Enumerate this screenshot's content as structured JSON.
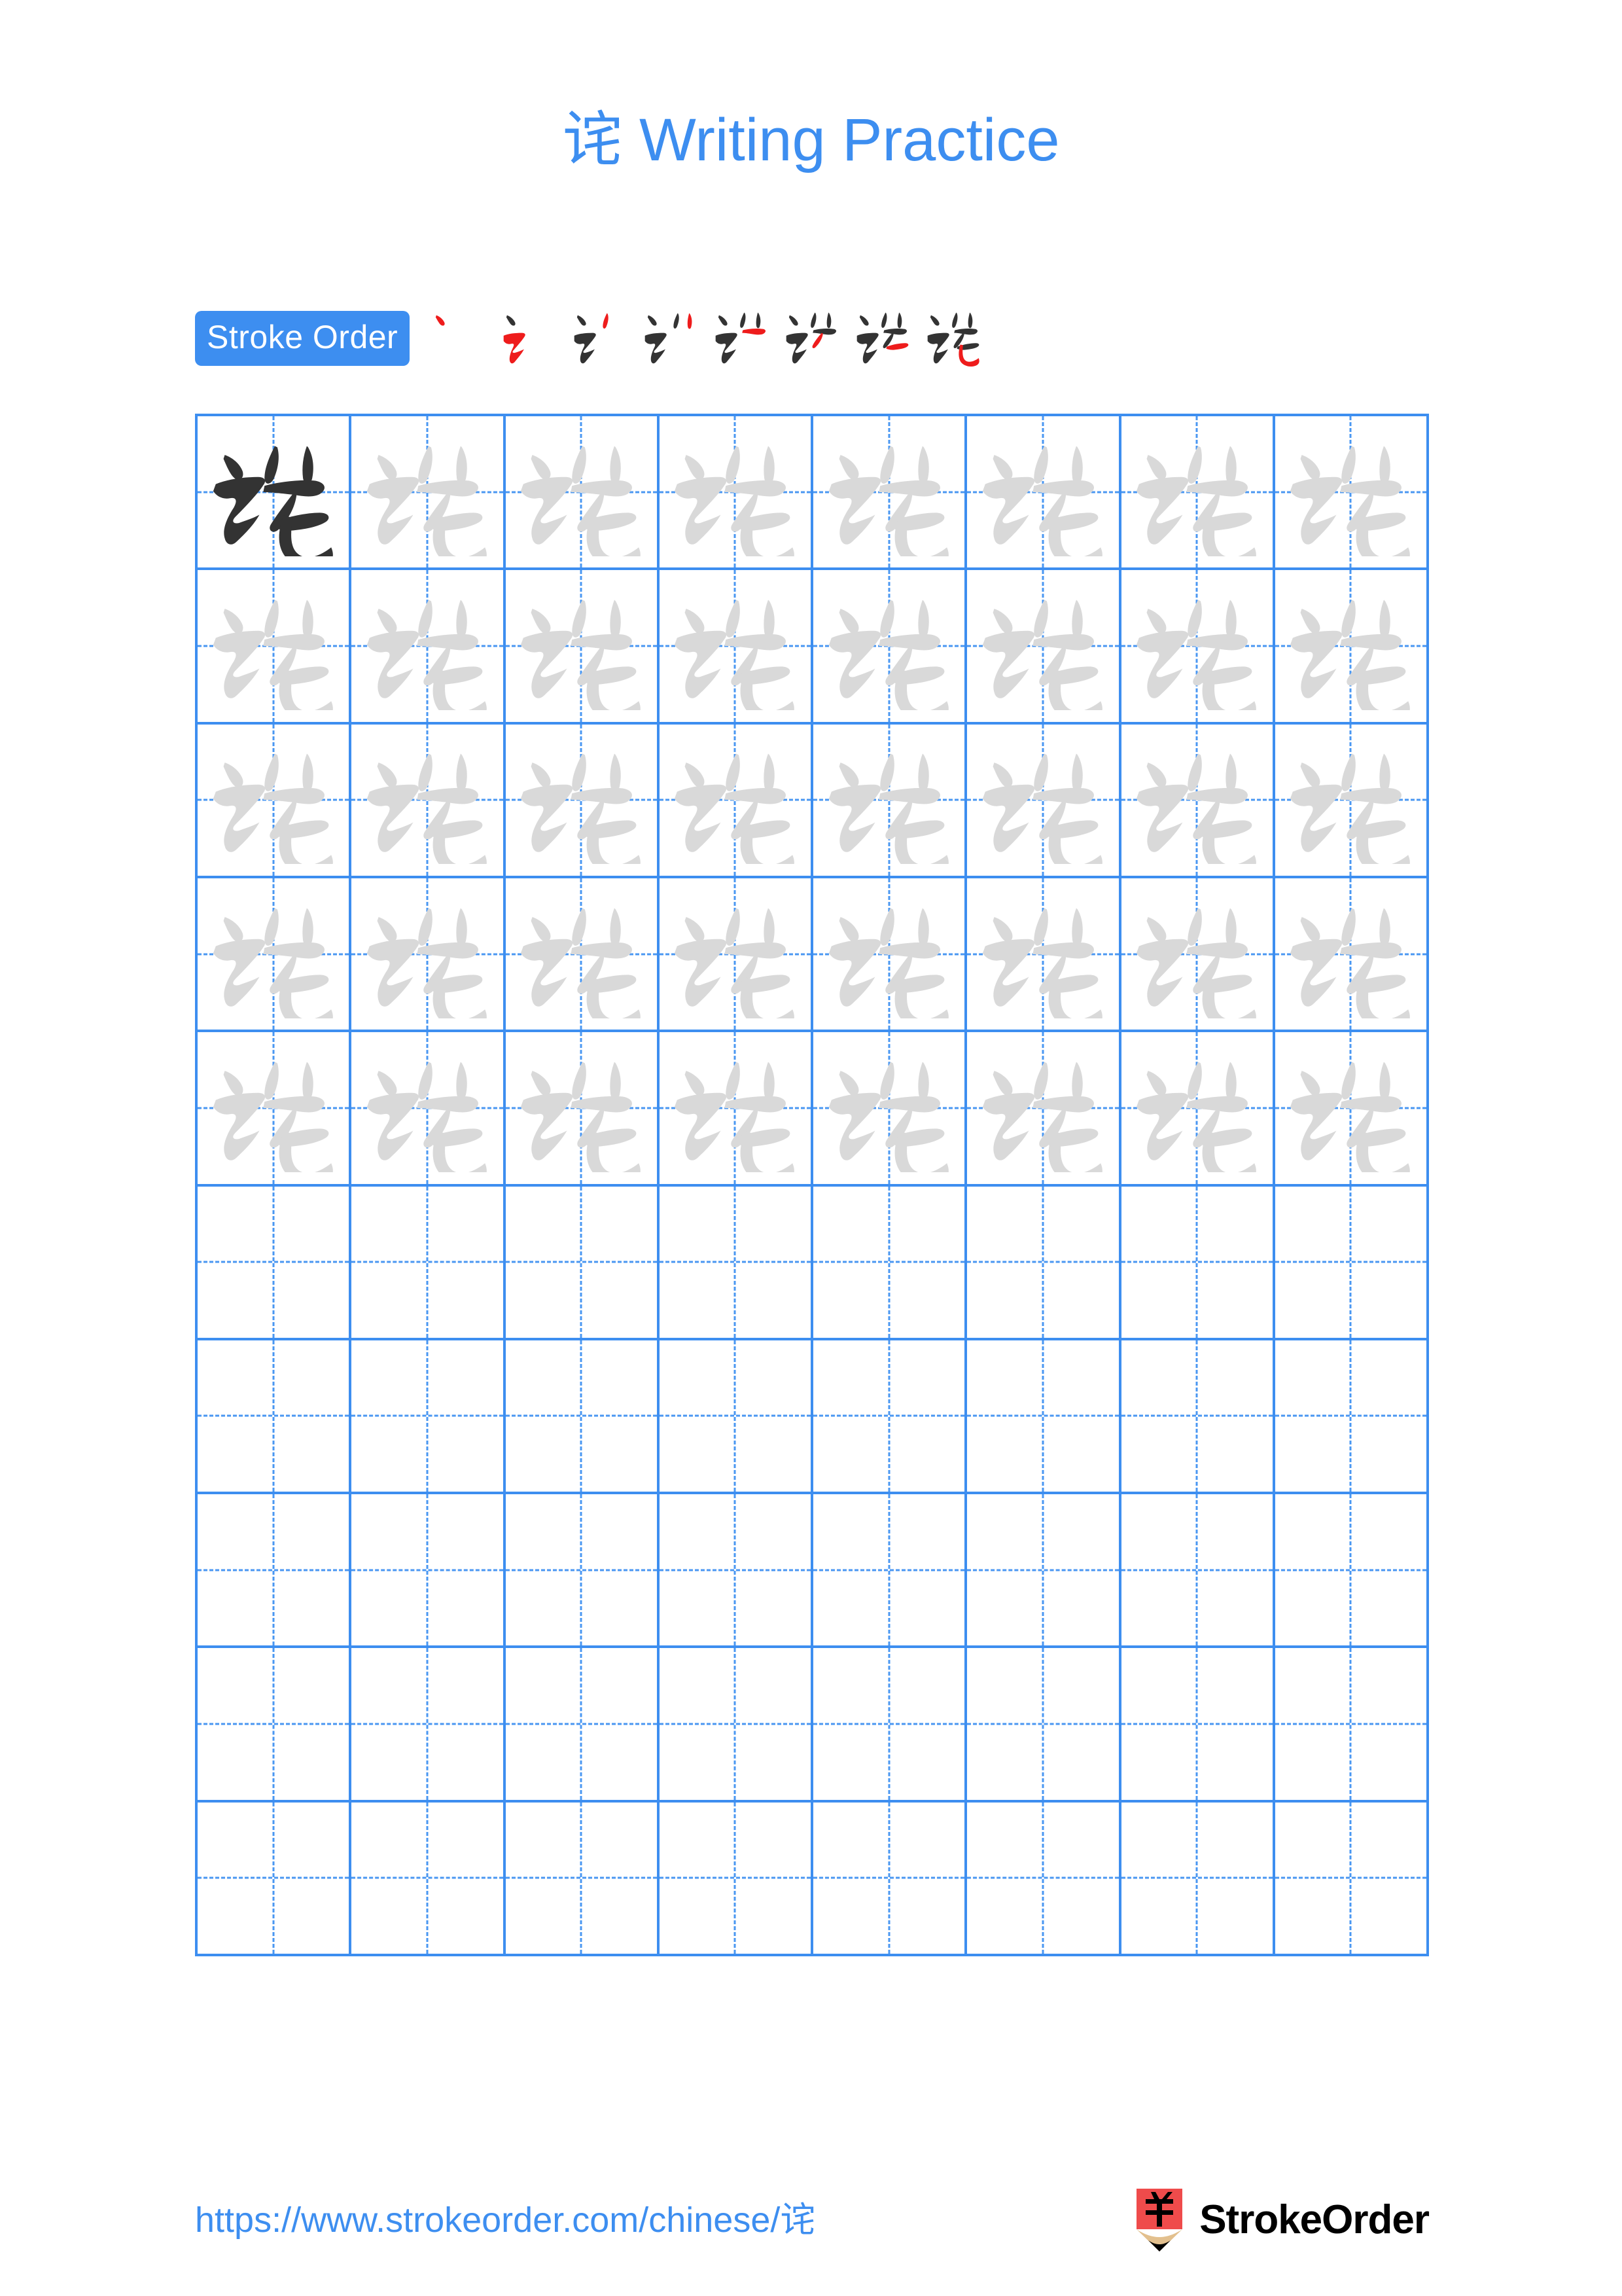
{
  "character": "诧",
  "header": {
    "title": "诧 Writing Practice"
  },
  "stroke_order": {
    "badge_label": "Stroke Order",
    "step_count": 8,
    "new_stroke_color": "#ee1c1c",
    "done_stroke_color": "#333333",
    "steps": [
      {
        "index": 1,
        "strokes_shown": 1,
        "new_stroke": "点 (dot)"
      },
      {
        "index": 2,
        "strokes_shown": 2,
        "new_stroke": "横折提 (horizontal-turn-rise)"
      },
      {
        "index": 3,
        "strokes_shown": 3,
        "new_stroke": "撇 (left-falling)"
      },
      {
        "index": 4,
        "strokes_shown": 4,
        "new_stroke": "点 (dot)"
      },
      {
        "index": 5,
        "strokes_shown": 5,
        "new_stroke": "横钩 (horizontal hook)"
      },
      {
        "index": 6,
        "strokes_shown": 6,
        "new_stroke": "撇 (left-falling)"
      },
      {
        "index": 7,
        "strokes_shown": 7,
        "new_stroke": "横 (horizontal)"
      },
      {
        "index": 8,
        "strokes_shown": 8,
        "new_stroke": "竖弯钩 (vertical-bend-hook)"
      }
    ]
  },
  "grid": {
    "columns": 8,
    "rows": 10,
    "filled_rows": 5,
    "border_color": "#3d8ef0",
    "guide_color": "#4a97f2",
    "model_glyph_color": "#333333",
    "trace_glyph_color": "#d9d9d9",
    "cells": [
      [
        "model",
        "trace",
        "trace",
        "trace",
        "trace",
        "trace",
        "trace",
        "trace"
      ],
      [
        "trace",
        "trace",
        "trace",
        "trace",
        "trace",
        "trace",
        "trace",
        "trace"
      ],
      [
        "trace",
        "trace",
        "trace",
        "trace",
        "trace",
        "trace",
        "trace",
        "trace"
      ],
      [
        "trace",
        "trace",
        "trace",
        "trace",
        "trace",
        "trace",
        "trace",
        "trace"
      ],
      [
        "trace",
        "trace",
        "trace",
        "trace",
        "trace",
        "trace",
        "trace",
        "trace"
      ],
      [
        "empty",
        "empty",
        "empty",
        "empty",
        "empty",
        "empty",
        "empty",
        "empty"
      ],
      [
        "empty",
        "empty",
        "empty",
        "empty",
        "empty",
        "empty",
        "empty",
        "empty"
      ],
      [
        "empty",
        "empty",
        "empty",
        "empty",
        "empty",
        "empty",
        "empty",
        "empty"
      ],
      [
        "empty",
        "empty",
        "empty",
        "empty",
        "empty",
        "empty",
        "empty",
        "empty"
      ],
      [
        "empty",
        "empty",
        "empty",
        "empty",
        "empty",
        "empty",
        "empty",
        "empty"
      ]
    ]
  },
  "footer": {
    "url": "https://www.strokeorder.com/chinese/诧",
    "brand_name": "StrokeOrder",
    "logo": {
      "glyph": "字",
      "body_color": "#ef4b4b",
      "wood_color": "#e3c08e",
      "tip_color": "#000000"
    }
  },
  "colors": {
    "accent_blue": "#3d8ef0",
    "grid_blue": "#3d8ef0",
    "ink_dark": "#333333",
    "ink_trace": "#d9d9d9",
    "stroke_red": "#ee1c1c",
    "background": "#ffffff"
  }
}
